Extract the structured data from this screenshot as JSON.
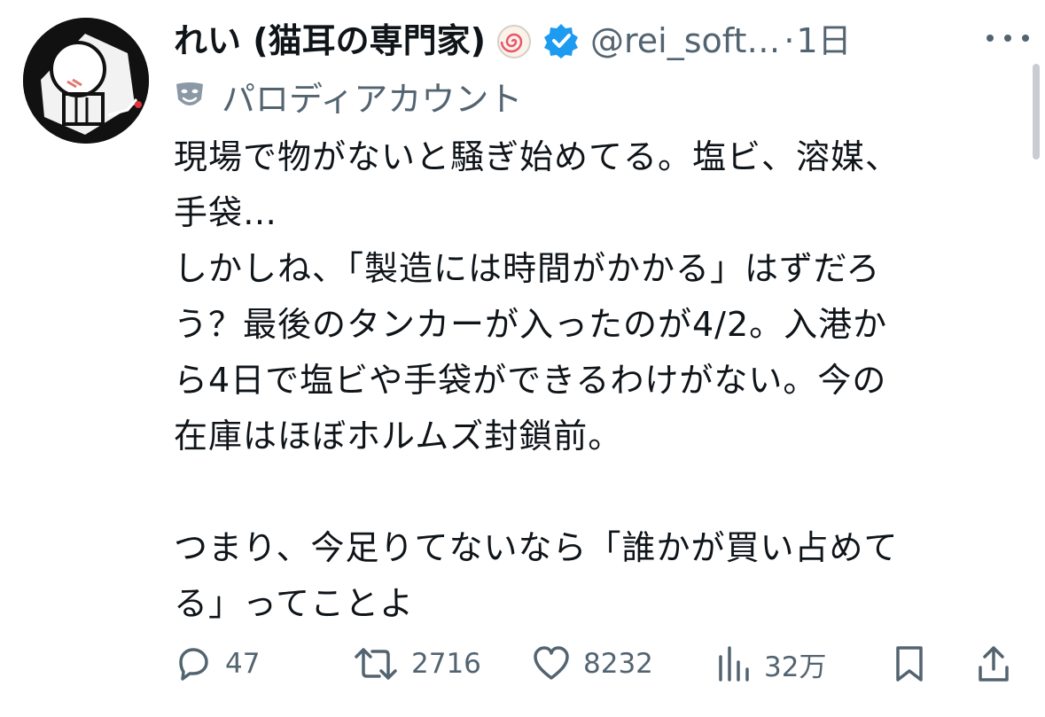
{
  "tweet": {
    "display_name": "れい (猫耳の専門家)",
    "handle": "@rei_soft…",
    "separator": "·",
    "time": "1日",
    "parody_label": "パロディアカウント",
    "text": "現場で物がないと騒ぎ始めてる。塩ビ、溶媒、\n手袋…\nしかしね、「製造には時間がかかる」はずだろ\nう？最後のタンカーが入ったのが4/2。入港か\nら4日で塩ビや手袋ができるわけがない。今の\n在庫はほぼホルムズ封鎖前。\n\nつまり、今足りてないなら「誰かが買い占めて\nる」ってことよ"
  },
  "actions": {
    "reply_count": "47",
    "retweet_count": "2716",
    "like_count": "8232",
    "views_count": "32万"
  },
  "icons": {
    "verified": "verified-badge-icon",
    "badge": "naruto-emoji-icon",
    "parody": "theater-masks-icon",
    "more": "more-icon",
    "reply": "reply-icon",
    "retweet": "retweet-icon",
    "like": "heart-icon",
    "views": "views-chart-icon",
    "bookmark": "bookmark-icon",
    "share": "share-icon"
  },
  "colors": {
    "text": "#0f1419",
    "secondary": "#536471",
    "verified": "#1d9bf0"
  }
}
